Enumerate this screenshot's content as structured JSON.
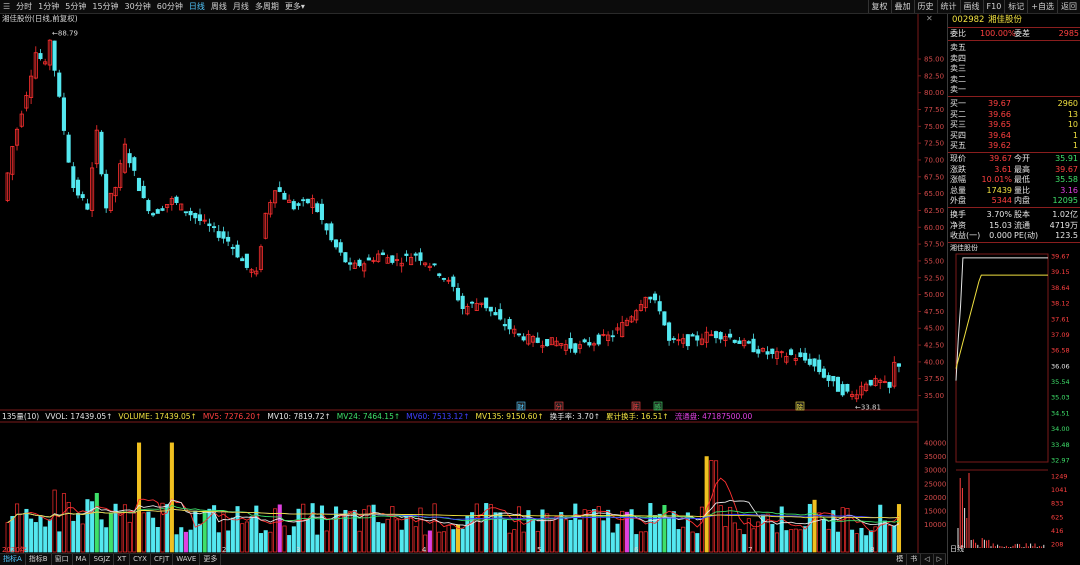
{
  "toolbar": {
    "periods": [
      "分时",
      "1分钟",
      "5分钟",
      "15分钟",
      "30分钟",
      "60分钟",
      "日线",
      "周线",
      "月线",
      "多周期",
      "更多▾"
    ],
    "active": "日线",
    "right_buttons": [
      "复权",
      "叠加",
      "历史",
      "统计",
      "画线",
      "F10",
      "标记",
      "+自选",
      "返回"
    ]
  },
  "chart": {
    "title": "湘佳股份(日线,前复权)",
    "high_label": "88.79",
    "low_label": "33.81",
    "price_ticks": [
      "85.00",
      "82.50",
      "80.00",
      "77.50",
      "75.00",
      "72.50",
      "70.00",
      "67.50",
      "65.00",
      "62.50",
      "60.00",
      "57.50",
      "55.00",
      "52.50",
      "50.00",
      "47.50",
      "45.00",
      "42.50",
      "40.00",
      "37.50",
      "35.00"
    ],
    "vol_ticks": [
      "40000",
      "35000",
      "30000",
      "25000",
      "20000",
      "15000",
      "10000"
    ],
    "x_labels": [
      "2020年",
      "2",
      "3",
      "4",
      "5",
      "6",
      "7",
      "8"
    ],
    "markers": [
      "财",
      "分",
      "陈",
      "感",
      "除"
    ]
  },
  "indicators": {
    "name": "135量(10)",
    "items": [
      {
        "text": "VVOL: 17439.05↑",
        "color": "#e6e6e6"
      },
      {
        "text": "VOLUME: 17439.05↑",
        "color": "#f0e040"
      },
      {
        "text": "MV5: 7276.20↑",
        "color": "#ff4040"
      },
      {
        "text": "MV10: 7819.72↑",
        "color": "#e6e6e6"
      },
      {
        "text": "MV24: 7464.15↑",
        "color": "#3ee06a"
      },
      {
        "text": "MV60: 7513.12↑",
        "color": "#4040ff"
      },
      {
        "text": "MV135: 9150.60↑",
        "color": "#f0e040"
      },
      {
        "text": "换手率: 3.70↑",
        "color": "#e6e6e6"
      },
      {
        "text": "累计换手: 16.51↑",
        "color": "#f0e040"
      },
      {
        "text": "流通盘: 47187500.00",
        "color": "#e040e0"
      }
    ]
  },
  "bottom_tabs": [
    "指标A",
    "指标B",
    "窗口",
    "MA",
    "SGJZ",
    "XT",
    "CYX",
    "CFJT",
    "WAVE",
    "更多"
  ],
  "bottom_right": [
    "模",
    "书",
    "◁",
    "▷"
  ],
  "panel": {
    "code": "002982",
    "name": "湘佳股份",
    "webi_label": "委比",
    "webi": "100.00%",
    "weicha_label": "委差",
    "weicha": "2985",
    "sells": [
      "卖五",
      "卖四",
      "卖三",
      "卖二",
      "卖一"
    ],
    "buys": [
      {
        "label": "买一",
        "price": "39.67",
        "vol": "2960"
      },
      {
        "label": "买二",
        "price": "39.66",
        "vol": "13"
      },
      {
        "label": "买三",
        "price": "39.65",
        "vol": "10"
      },
      {
        "label": "买四",
        "price": "39.64",
        "vol": "1"
      },
      {
        "label": "买五",
        "price": "39.62",
        "vol": "1"
      }
    ],
    "quote": [
      {
        "l1": "现价",
        "v1": "39.67",
        "c1": "red",
        "l2": "今开",
        "v2": "35.91",
        "c2": "green"
      },
      {
        "l1": "涨跌",
        "v1": "3.61",
        "c1": "red",
        "l2": "最高",
        "v2": "39.67",
        "c2": "red"
      },
      {
        "l1": "涨幅",
        "v1": "10.01%",
        "c1": "red",
        "l2": "最低",
        "v2": "35.58",
        "c2": "green"
      },
      {
        "l1": "总量",
        "v1": "17439",
        "c1": "yel",
        "l2": "量比",
        "v2": "3.16",
        "c2": "mag"
      },
      {
        "l1": "外盘",
        "v1": "5344",
        "c1": "red",
        "l2": "内盘",
        "v2": "12095",
        "c2": "green"
      }
    ],
    "stats": [
      {
        "l1": "换手",
        "v1": "3.70%",
        "l2": "股本",
        "v2": "1.02亿"
      },
      {
        "l1": "净资",
        "v1": "15.03",
        "l2": "流通",
        "v2": "4719万"
      },
      {
        "l1": "收益(一)",
        "v1": "0.000",
        "l2": "PE(动)",
        "v2": "123.5"
      }
    ],
    "mini_title": "湘佳股份",
    "mini_price_ticks": [
      "39.67",
      "39.15",
      "38.64",
      "38.12",
      "37.61",
      "37.09",
      "36.58",
      "36.06",
      "35.54",
      "35.03",
      "34.51",
      "34.00",
      "33.48",
      "32.97"
    ],
    "mini_vol_ticks": [
      "1249",
      "1041",
      "833",
      "625",
      "416",
      "208"
    ],
    "bottom_label": "日线"
  },
  "colors": {
    "up": "#ff3030",
    "down": "#54e8f0",
    "grid": "#5a1414",
    "bg": "#000000"
  }
}
